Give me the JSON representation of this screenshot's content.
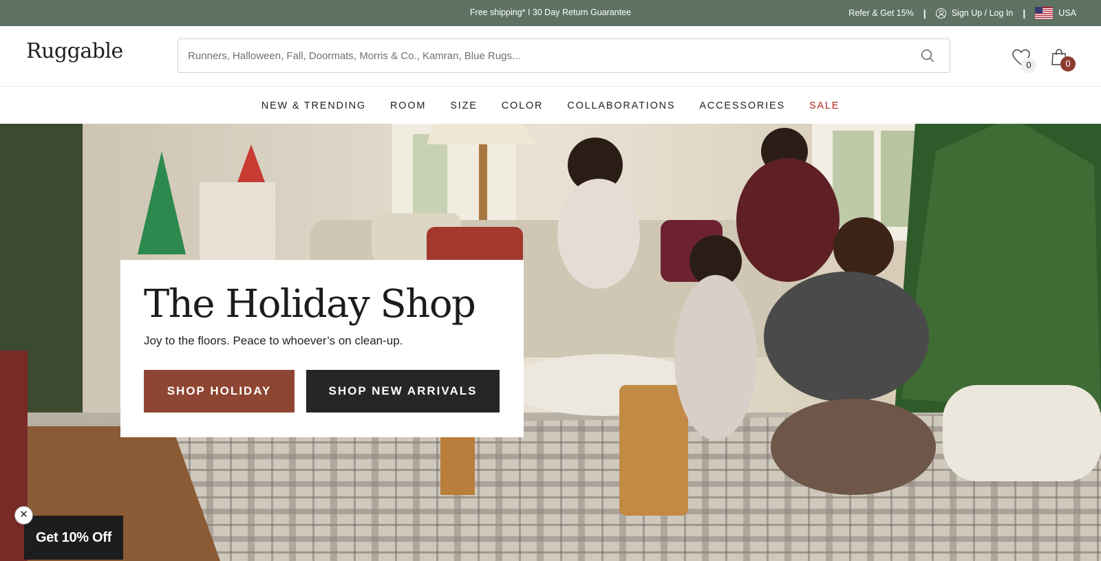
{
  "announcement": {
    "center_text": "Free shipping* I 30 Day Return Guarantee",
    "refer_label": "Refer & Get 15%",
    "separator": "|",
    "signup_label": "Sign Up / Log In",
    "region_label": "USA"
  },
  "header": {
    "logo": "Ruggable",
    "search_placeholder": "Runners, Halloween, Fall, Doormats, Morris & Co., Kamran, Blue Rugs...",
    "wishlist_count": "0",
    "cart_count": "0"
  },
  "nav": {
    "items": [
      {
        "label": "NEW & TRENDING"
      },
      {
        "label": "ROOM"
      },
      {
        "label": "SIZE"
      },
      {
        "label": "COLOR"
      },
      {
        "label": "COLLABORATIONS"
      },
      {
        "label": "ACCESSORIES"
      },
      {
        "label": "SALE"
      }
    ]
  },
  "hero": {
    "title": "The Holiday Shop",
    "subtitle": "Joy to the floors. Peace to whoever’s on clean-up.",
    "primary_button": "SHOP HOLIDAY",
    "secondary_button": "SHOP NEW ARRIVALS"
  },
  "popup": {
    "close_glyph": "✕",
    "offer_label": "Get 10% Off"
  },
  "colors": {
    "announcement_bg": "#5e7263",
    "sale_accent": "#b3261e",
    "primary_button_bg": "#8e4633",
    "secondary_button_bg": "#262626",
    "cart_badge_bg": "#8e3c2e"
  },
  "icons": [
    "user-icon",
    "us-flag-icon",
    "search-icon",
    "heart-icon",
    "shopping-bag-icon",
    "close-icon"
  ]
}
